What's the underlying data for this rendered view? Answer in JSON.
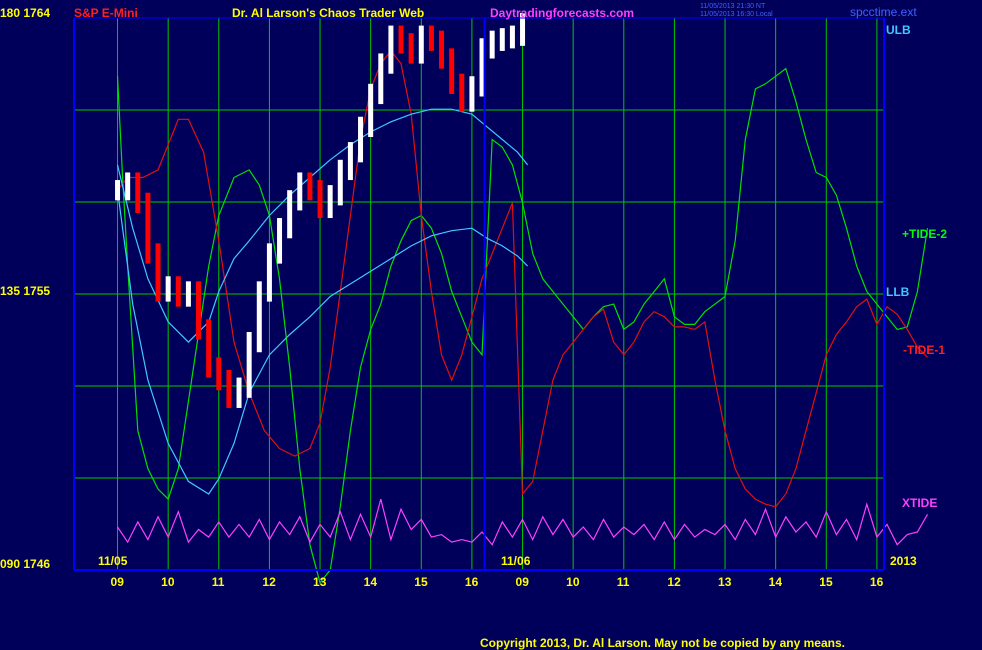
{
  "header": {
    "symbol": "S&P E-Mini",
    "title": "Dr. Al Larson's Chaos Trader Web",
    "site": "Daytradingforecasts.com",
    "timestamp_1": "11/05/2013 21:30 NT",
    "timestamp_2": "11/05/2013 16:30 Local",
    "file": "spcctime.ext"
  },
  "footer": {
    "copyright": "Copyright 2013, Dr. Al Larson. May not be copied by any means."
  },
  "colors": {
    "background": "#00005a",
    "grid": "#00c800",
    "frame": "#0000ff",
    "price_up": "#ffffff",
    "price_down": "#ff0000",
    "tide_plus": "#00e000",
    "tide_minus": "#e01010",
    "envelope": "#40c8ff",
    "xtide": "#ff40ff",
    "symbol_text": "#ff2020",
    "title_text": "#ffff00",
    "site_text": "#ff40ff",
    "year_text": "#ffff00"
  },
  "chart_data": {
    "type": "line",
    "y_axis_labels": [
      "180 1764",
      "135 1755",
      "090 1746"
    ],
    "x_axis_labels": [
      "09",
      "10",
      "11",
      "12",
      "13",
      "14",
      "15",
      "16",
      "09",
      "10",
      "11",
      "12",
      "13",
      "14",
      "15",
      "16"
    ],
    "date_labels": [
      "11/05",
      "11/06"
    ],
    "year_label": "2013",
    "right_labels": {
      "ulb": "ULB",
      "tide_plus": "+TIDE-2",
      "llb": "LLB",
      "tide_minus": "-TIDE-1",
      "xtide": "XTIDE"
    },
    "series": [
      {
        "name": "+TIDE-2",
        "x": [
          0,
          0.1,
          0.2,
          0.4,
          0.6,
          0.8,
          1.0,
          1.2,
          1.5,
          1.8,
          2.0,
          2.3,
          2.6,
          2.8,
          3.0,
          3.2,
          3.4,
          3.6,
          3.8,
          4.0,
          4.2,
          4.4,
          4.6,
          4.8,
          5.0,
          5.2,
          5.4,
          5.6,
          5.8,
          6.0,
          6.2,
          6.4,
          6.6,
          6.8,
          7.0,
          7.2,
          7.4,
          7.6,
          7.8,
          8.0,
          8.2,
          8.4,
          8.6,
          8.8,
          9.0,
          9.2,
          9.4,
          9.6,
          9.8,
          10.0,
          10.2,
          10.4,
          10.6,
          10.8,
          11.0,
          11.2,
          11.4,
          11.6,
          11.8,
          12.0,
          12.2,
          12.4,
          12.6,
          12.8,
          13.0,
          13.2,
          13.4,
          13.6,
          13.8,
          14.0,
          14.2,
          14.4,
          14.6,
          14.8,
          15.0,
          15.2,
          15.4,
          15.6,
          15.8,
          16.0
        ],
        "y": [
          1764.5,
          1760.5,
          1757,
          1750.5,
          1749,
          1748.2,
          1747.8,
          1749,
          1753,
          1757,
          1759,
          1760.5,
          1760.8,
          1760.2,
          1759,
          1756.5,
          1753,
          1749,
          1746,
          1744.5,
          1745,
          1747.5,
          1750.5,
          1753,
          1754.5,
          1755.5,
          1757,
          1758,
          1758.8,
          1759,
          1758.5,
          1757.5,
          1756,
          1755,
          1754,
          1753.5,
          1762,
          1761.7,
          1761,
          1759.5,
          1757.5,
          1756.5,
          1756,
          1755.5,
          1755,
          1754.5,
          1755,
          1755.4,
          1755.5,
          1754.5,
          1754.8,
          1755.5,
          1756,
          1756.5,
          1755,
          1754.7,
          1754.7,
          1755.2,
          1755.5,
          1755.8,
          1758,
          1762,
          1764,
          1764.2,
          1764.5,
          1764.8,
          1763.5,
          1762,
          1760.7,
          1760.5,
          1759.8,
          1758.5,
          1757,
          1756,
          1755.5,
          1755,
          1754.5,
          1754.6,
          1756,
          1758.5
        ]
      },
      {
        "name": "-TIDE-1",
        "x": [
          0,
          0.2,
          0.5,
          0.8,
          1.0,
          1.2,
          1.4,
          1.7,
          2.0,
          2.3,
          2.6,
          2.9,
          3.2,
          3.5,
          3.8,
          4.0,
          4.2,
          4.4,
          4.6,
          4.8,
          5.0,
          5.2,
          5.4,
          5.6,
          5.8,
          6.0,
          6.2,
          6.4,
          6.6,
          6.8,
          7.0,
          7.2,
          7.4,
          7.6,
          7.8,
          8.0,
          8.2,
          8.4,
          8.6,
          8.8,
          9.0,
          9.2,
          9.4,
          9.6,
          9.8,
          10.0,
          10.2,
          10.4,
          10.6,
          10.8,
          11.0,
          11.2,
          11.4,
          11.6,
          11.8,
          12.0,
          12.2,
          12.4,
          12.6,
          12.8,
          13.0,
          13.2,
          13.4,
          13.6,
          13.8,
          14.0,
          14.2,
          14.4,
          14.6,
          14.8,
          15.0,
          15.2,
          15.4,
          15.6,
          15.8,
          16.0
        ],
        "y": [
          1760,
          1760.5,
          1760.5,
          1760.8,
          1761.8,
          1762.8,
          1762.8,
          1761.5,
          1758,
          1754,
          1752,
          1750.5,
          1749.8,
          1749.5,
          1749.8,
          1750.8,
          1753,
          1756,
          1759,
          1762,
          1764,
          1765,
          1765.5,
          1765,
          1763,
          1759,
          1756,
          1753.5,
          1752.5,
          1753.5,
          1755,
          1756.5,
          1757.5,
          1758.5,
          1759.5,
          1748,
          1748.5,
          1750.5,
          1752.5,
          1753.5,
          1754,
          1754.5,
          1755,
          1755.3,
          1754,
          1753.5,
          1754,
          1754.8,
          1755.2,
          1755,
          1754.6,
          1754.6,
          1754.5,
          1754.8,
          1752.5,
          1750.5,
          1749,
          1748.2,
          1747.8,
          1747.6,
          1747.5,
          1748,
          1749,
          1750.5,
          1752,
          1753.5,
          1754.3,
          1754.8,
          1755.4,
          1755.7,
          1754.7,
          1755.4,
          1755.1,
          1754.5,
          1753.8,
          1753.4
        ]
      },
      {
        "name": "Upper envelope",
        "x": [
          0,
          0.3,
          0.6,
          1.0,
          1.4,
          1.8,
          2.0,
          2.3,
          2.6,
          3.0,
          3.4,
          3.8,
          4.2,
          4.6,
          5.0,
          5.4,
          5.8,
          6.2,
          6.6,
          7.0,
          7.3,
          7.6,
          7.9,
          8.1
        ],
        "y": [
          1761,
          1758.5,
          1756.5,
          1754.8,
          1754,
          1754.8,
          1756,
          1757.3,
          1758,
          1759,
          1759.8,
          1760.5,
          1761.2,
          1761.8,
          1762.3,
          1762.7,
          1763,
          1763.2,
          1763.2,
          1763,
          1762.5,
          1762,
          1761.5,
          1761
        ]
      },
      {
        "name": "Lower envelope",
        "x": [
          0,
          0.3,
          0.6,
          1.0,
          1.4,
          1.8,
          2.0,
          2.3,
          2.6,
          3.0,
          3.4,
          3.8,
          4.2,
          4.6,
          5.0,
          5.4,
          5.8,
          6.2,
          6.6,
          7.0,
          7.3,
          7.6,
          7.9,
          8.1
        ],
        "y": [
          1760,
          1755.5,
          1752.5,
          1750,
          1748.5,
          1748,
          1748.6,
          1750,
          1752,
          1753.5,
          1754.3,
          1755,
          1755.8,
          1756.3,
          1756.8,
          1757.3,
          1757.8,
          1758.2,
          1758.4,
          1758.5,
          1758.1,
          1757.8,
          1757.4,
          1757
        ]
      },
      {
        "name": "XTIDE",
        "x": [
          0,
          0.2,
          0.4,
          0.6,
          0.8,
          1.0,
          1.2,
          1.4,
          1.6,
          1.8,
          2.0,
          2.2,
          2.4,
          2.6,
          2.8,
          3.0,
          3.2,
          3.4,
          3.6,
          3.8,
          4.0,
          4.2,
          4.4,
          4.6,
          4.8,
          5.0,
          5.2,
          5.4,
          5.6,
          5.8,
          6.0,
          6.2,
          6.4,
          6.6,
          6.8,
          7.0,
          7.2,
          7.4,
          7.6,
          7.8,
          8.0,
          8.2,
          8.4,
          8.6,
          8.8,
          9.0,
          9.2,
          9.4,
          9.6,
          9.8,
          10.0,
          10.2,
          10.4,
          10.6,
          10.8,
          11.0,
          11.2,
          11.4,
          11.6,
          11.8,
          12.0,
          12.2,
          12.4,
          12.6,
          12.8,
          13.0,
          13.2,
          13.4,
          13.6,
          13.8,
          14.0,
          14.2,
          14.4,
          14.6,
          14.8,
          15.0,
          15.2,
          15.4,
          15.6,
          15.8,
          16.0
        ],
        "y": [
          1746.7,
          1746.1,
          1746.9,
          1746.2,
          1747.1,
          1746.3,
          1747.3,
          1746.1,
          1746.6,
          1746.3,
          1746.9,
          1746.3,
          1746.8,
          1746.3,
          1747.0,
          1746.2,
          1746.9,
          1746.4,
          1747.1,
          1746.1,
          1746.8,
          1746.3,
          1747.3,
          1746.2,
          1747.2,
          1746.3,
          1747.8,
          1746.2,
          1747.4,
          1746.6,
          1747.0,
          1746.3,
          1746.4,
          1746.1,
          1746.2,
          1746.1,
          1746.5,
          1746.0,
          1746.9,
          1746.3,
          1747.0,
          1746.2,
          1747.1,
          1746.4,
          1747.0,
          1746.3,
          1746.7,
          1746.2,
          1747.0,
          1746.3,
          1746.7,
          1746.4,
          1746.8,
          1746.2,
          1746.9,
          1746.2,
          1746.8,
          1746.3,
          1746.6,
          1746.4,
          1746.8,
          1746.2,
          1747.0,
          1746.4,
          1747.4,
          1746.3,
          1747.1,
          1746.5,
          1746.9,
          1746.3,
          1747.3,
          1746.4,
          1747.0,
          1746.2,
          1747.6,
          1746.3,
          1746.8,
          1746.0,
          1746.4,
          1746.5,
          1747.2
        ]
      }
    ],
    "price_bars": {
      "x": [
        0.0,
        0.2,
        0.4,
        0.6,
        0.8,
        1.0,
        1.2,
        1.4,
        1.6,
        1.8,
        2.0,
        2.2,
        2.4,
        2.6,
        2.8,
        3.0,
        3.2,
        3.4,
        3.6,
        3.8,
        4.0,
        4.2,
        4.4,
        4.6,
        4.8,
        5.0,
        5.2,
        5.4,
        5.6,
        5.8,
        6.0,
        6.2,
        6.4,
        6.6,
        6.8,
        7.0,
        7.2,
        7.4,
        7.6,
        7.8,
        8.0
      ],
      "close": [
        1760.0,
        1760.3,
        1759.5,
        1757.5,
        1756.0,
        1756.2,
        1755.8,
        1756.0,
        1754.5,
        1753.0,
        1752.5,
        1751.8,
        1752.2,
        1754.0,
        1756.0,
        1757.5,
        1758.5,
        1759.6,
        1760.3,
        1760.0,
        1759.3,
        1759.8,
        1760.8,
        1761.5,
        1762.5,
        1763.8,
        1765.0,
        1766.1,
        1765.8,
        1765.4,
        1766.1,
        1765.9,
        1765.2,
        1764.2,
        1763.5,
        1764.1,
        1765.6,
        1765.9,
        1766.0,
        1766.1,
        1766.6
      ]
    }
  }
}
